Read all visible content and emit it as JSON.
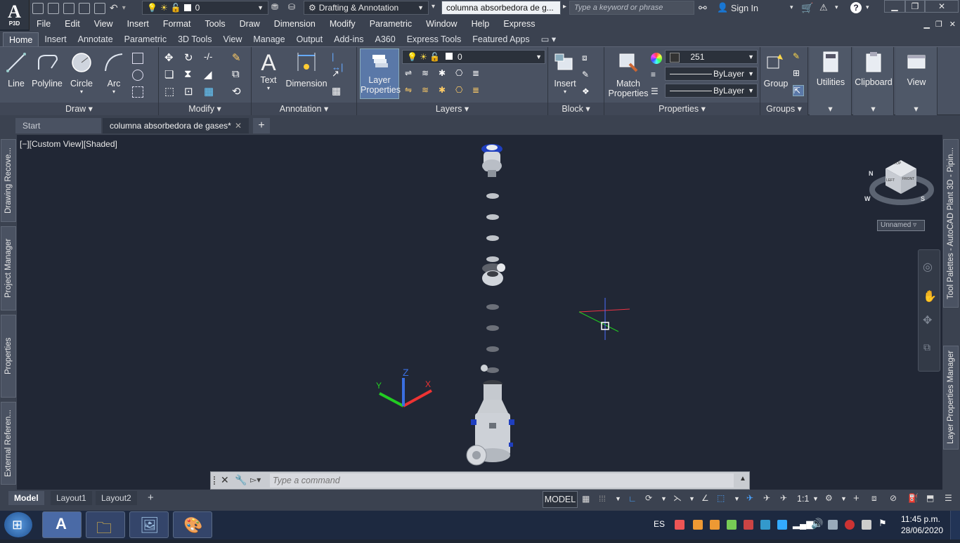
{
  "app": {
    "logo_letter": "A",
    "logo_sub": "P3D",
    "workspace": "Drafting & Annotation",
    "document_title": "columna absorbedora de g...",
    "search_placeholder": "Type a keyword or phrase",
    "sign_in": "Sign In",
    "layer_value": "0"
  },
  "menubar": [
    "File",
    "Edit",
    "View",
    "Insert",
    "Format",
    "Tools",
    "Draw",
    "Dimension",
    "Modify",
    "Parametric",
    "Window",
    "Help",
    "Express"
  ],
  "ribbon_tabs": [
    "Home",
    "Insert",
    "Annotate",
    "Parametric",
    "3D Tools",
    "View",
    "Manage",
    "Output",
    "Add-ins",
    "A360",
    "Express Tools",
    "Featured Apps"
  ],
  "ribbon": {
    "draw": {
      "title": "Draw",
      "line": "Line",
      "polyline": "Polyline",
      "circle": "Circle",
      "arc": "Arc"
    },
    "modify": {
      "title": "Modify"
    },
    "annotation": {
      "title": "Annotation",
      "text": "Text",
      "dimension": "Dimension"
    },
    "layers": {
      "title": "Layers",
      "layer_properties_1": "Layer",
      "layer_properties_2": "Properties",
      "current_layer": "0"
    },
    "block": {
      "title": "Block",
      "insert": "Insert"
    },
    "properties": {
      "title": "Properties",
      "match_1": "Match",
      "match_2": "Properties",
      "color": "251",
      "linetype": "ByLayer",
      "lineweight": "ByLayer"
    },
    "groups": {
      "title": "Groups",
      "group": "Group"
    },
    "utilities": "Utilities",
    "clipboard": "Clipboard",
    "view": "View"
  },
  "doc_tabs": {
    "start": "Start",
    "active": "columna absorbedora de gases*"
  },
  "viewport": {
    "label": "[−][Custom View][Shaded]",
    "viewcube_top": "TOP",
    "viewcube_left": "LEFT",
    "viewcube_front": "FRONT",
    "compass_n": "N",
    "compass_w": "W",
    "compass_s": "S",
    "ucs_label": "Unnamed",
    "axis_x": "X",
    "axis_y": "Y",
    "axis_z": "Z"
  },
  "side_left": [
    "Drawing Recove...",
    "Project Manager",
    "Properties",
    "External Referen..."
  ],
  "side_right": [
    "Tool Palettes - AutoCAD Plant 3D - Pipin...",
    "Layer Properties Manager"
  ],
  "command": {
    "placeholder": "Type a command"
  },
  "layout_tabs": [
    "Model",
    "Layout1",
    "Layout2"
  ],
  "status": {
    "model": "MODEL",
    "scale": "1:1"
  },
  "taskbar": {
    "lang": "ES",
    "time": "11:45 p.m.",
    "date": "28/06/2020"
  },
  "colors": {
    "accent_blue": "#2a5fbf",
    "background": "#212735",
    "ribbon": "#4a5262"
  }
}
